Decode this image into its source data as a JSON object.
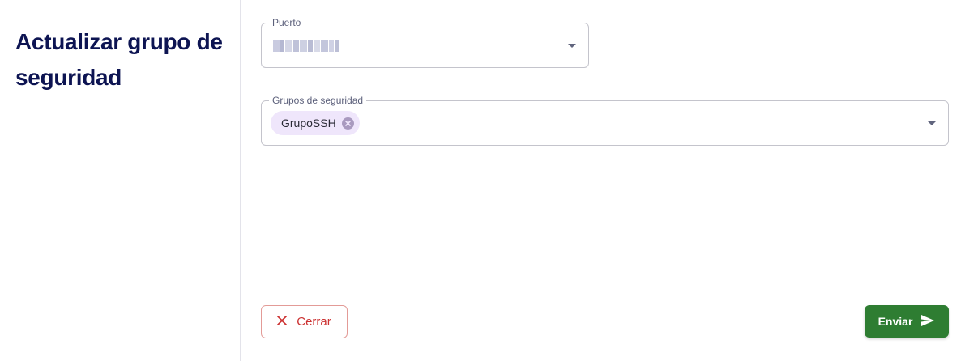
{
  "header": {
    "title": "Actualizar grupo de seguridad"
  },
  "form": {
    "port": {
      "label": "Puerto",
      "value_redacted": true
    },
    "security_groups": {
      "label": "Grupos de seguridad",
      "chips": [
        {
          "label": "GrupoSSH"
        }
      ]
    }
  },
  "actions": {
    "close_label": "Cerrar",
    "send_label": "Enviar"
  },
  "icons": {
    "port_dropdown": "chevron-down-icon",
    "groups_dropdown": "chevron-down-icon",
    "chip_delete": "cancel-circle-icon",
    "close": "close-icon",
    "send": "send-icon"
  },
  "colors": {
    "title": "#0d1452",
    "chip_bg": "#efe6fb",
    "close_text": "#cc3232",
    "close_border": "#e39b97",
    "send_bg": "#2e7d32"
  }
}
